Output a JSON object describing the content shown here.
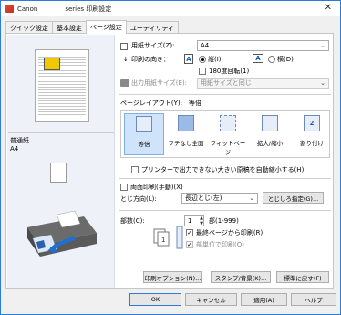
{
  "window": {
    "title_left": "Canon",
    "title_right": "series 印刷設定",
    "close": "✕"
  },
  "tabs": [
    "クイック設定",
    "基本設定",
    "ページ設定",
    "ユーティリティ"
  ],
  "active_tab": 2,
  "preview": {
    "paper_type": "普通紙",
    "paper_size": "A4"
  },
  "form": {
    "paper_size_label": "用紙サイズ(Z):",
    "paper_size_value": "A4",
    "orientation_label": "印刷の向き：",
    "portrait_label": "縦(I)",
    "landscape_label": "横(D)",
    "rotate_label": "180度回転(1)",
    "output_size_label": "出力用紙サイズ(E):",
    "output_size_value": "用紙サイズと同じ",
    "page_layout_label": "ページレイアウト(Y):",
    "page_layout_value": "等倍",
    "layouts": [
      "等倍",
      "フチなし全面",
      "フィットページ",
      "拡大/縮小",
      "割り付け"
    ],
    "auto_reduce_label": "プリンターで出力できない大きい原稿を自動縮小する(H)",
    "duplex_label": "両面印刷(手動)(X)",
    "binding_label": "とじ方向(L):",
    "binding_value": "長辺とじ(左)",
    "margin_button": "とじしろ指定(G)...",
    "copies_label": "部数(C):",
    "copies_value": "1",
    "copies_range": "部(1-999)",
    "last_page_first_label": "最終ページから印刷(R)",
    "collate_label": "部単位で印刷(O)"
  },
  "buttons": {
    "print_options": "印刷オプション(N)...",
    "stamp": "スタンプ/背景(K)...",
    "defaults": "標準に戻す(F)",
    "ok": "OK",
    "cancel": "キャンセル",
    "apply": "適用(A)",
    "help": "ヘルプ"
  },
  "colors": {
    "accent": "#2d7bd6",
    "selected_bg": "#cfe3fb"
  }
}
